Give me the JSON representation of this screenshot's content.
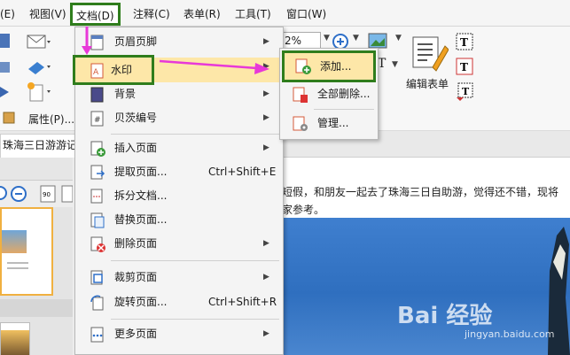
{
  "menubar": {
    "items": [
      {
        "label": "(E)"
      },
      {
        "label": "视图(V)"
      },
      {
        "label": "文档(D)"
      },
      {
        "label": "注释(C)"
      },
      {
        "label": "表单(R)"
      },
      {
        "label": "工具(T)"
      },
      {
        "label": "窗口(W)"
      }
    ]
  },
  "ribbon": {
    "zoom_value": "2%",
    "properties_label": "属性(P)...",
    "edit_form_label": "编辑表单"
  },
  "tab": {
    "title": "珠海三日游游记"
  },
  "document": {
    "line1": "短假，和朋友一起去了珠海三日自助游，觉得还不错，现将",
    "line2": "家参考。",
    "watermark": "Bai 经验",
    "watermark_sub": "jingyan.baidu.com"
  },
  "doc_menu": {
    "items": [
      {
        "label": "页眉页脚",
        "arrow": "▶"
      },
      {
        "label": "水印",
        "arrow": "▶"
      },
      {
        "label": "背景",
        "arrow": "▶"
      },
      {
        "label": "贝茨编号",
        "arrow": "▶"
      },
      {
        "label": "插入页面",
        "arrow": "▶"
      },
      {
        "label": "提取页面...",
        "shortcut": "Ctrl+Shift+E"
      },
      {
        "label": "拆分文档..."
      },
      {
        "label": "替换页面..."
      },
      {
        "label": "删除页面",
        "arrow": "▶"
      },
      {
        "label": "裁剪页面",
        "arrow": "▶"
      },
      {
        "label": "旋转页面...",
        "shortcut": "Ctrl+Shift+R"
      },
      {
        "label": "更多页面",
        "arrow": "▶"
      }
    ]
  },
  "watermark_menu": {
    "items": [
      {
        "label": "添加..."
      },
      {
        "label": "全部删除..."
      },
      {
        "label": "管理..."
      }
    ]
  },
  "colors": {
    "highlight_border": "#2f7d1c",
    "highlight_fill": "#fde7a8",
    "arrow": "#e838d8"
  }
}
